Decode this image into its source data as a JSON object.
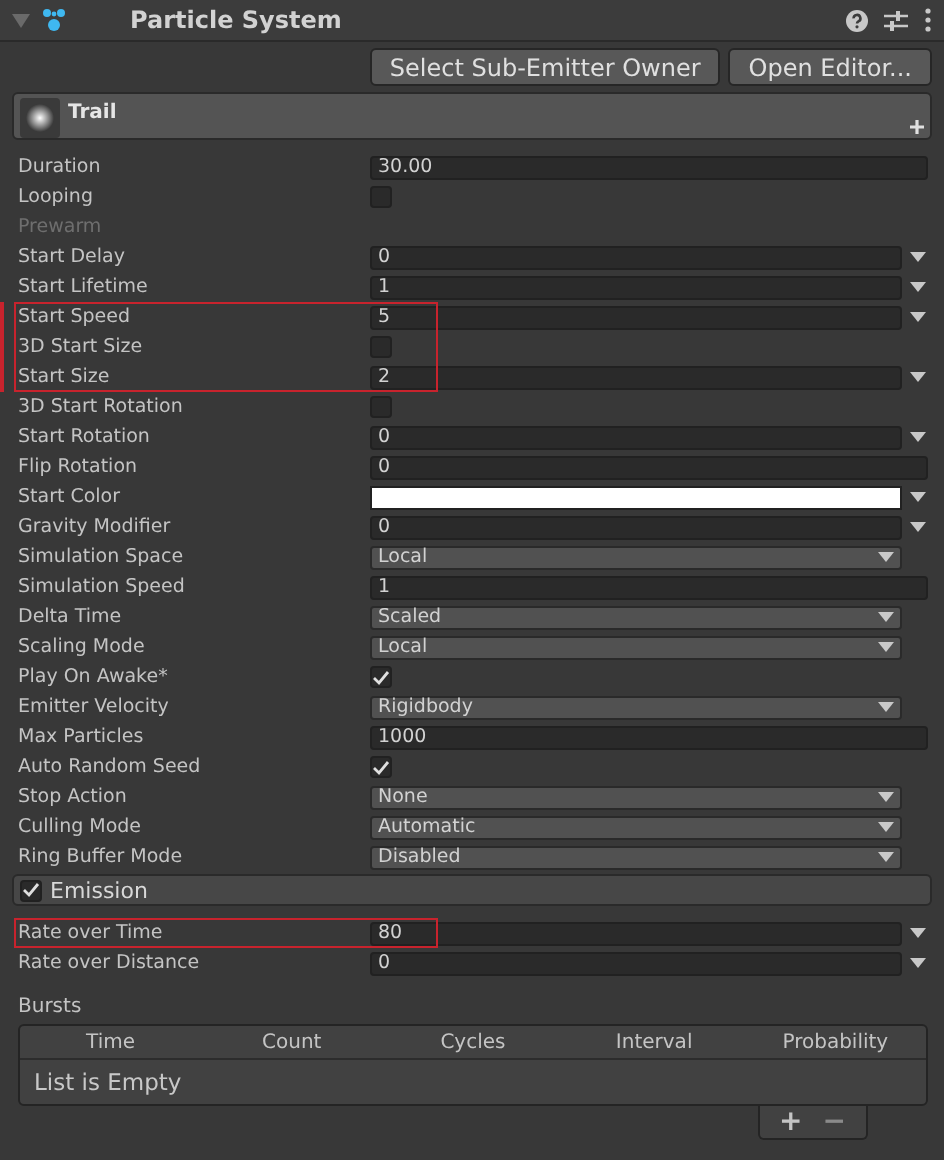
{
  "component": {
    "title": "Particle System",
    "expanded": true
  },
  "toolbar_buttons": [
    "Select Sub-Emitter Owner",
    "Open Editor..."
  ],
  "module": {
    "title": "Trail"
  },
  "rows": [
    {
      "label": "Duration",
      "kind": "field",
      "value": "30.00",
      "curve": false,
      "highlighted": false,
      "modified": false
    },
    {
      "label": "Looping",
      "kind": "checkbox",
      "checked": false,
      "highlighted": false,
      "modified": false
    },
    {
      "label": "Prewarm",
      "kind": "label",
      "disabled": true,
      "highlighted": false,
      "modified": false
    },
    {
      "label": "Start Delay",
      "kind": "field",
      "value": "0",
      "curve": true,
      "highlighted": false,
      "modified": false
    },
    {
      "label": "Start Lifetime",
      "kind": "field",
      "value": "1",
      "curve": true,
      "highlighted": false,
      "modified": false
    },
    {
      "label": "Start Speed",
      "kind": "field",
      "value": "5",
      "curve": true,
      "highlighted": true,
      "modified": true
    },
    {
      "label": "3D Start Size",
      "kind": "checkbox",
      "checked": false,
      "highlighted": true,
      "modified": true
    },
    {
      "label": "Start Size",
      "kind": "field",
      "value": "2",
      "curve": true,
      "highlighted": true,
      "modified": true
    },
    {
      "label": "3D Start Rotation",
      "kind": "checkbox",
      "checked": false,
      "highlighted": false,
      "modified": false
    },
    {
      "label": "Start Rotation",
      "kind": "field",
      "value": "0",
      "curve": true,
      "highlighted": false,
      "modified": false
    },
    {
      "label": "Flip Rotation",
      "kind": "field",
      "value": "0",
      "curve": false,
      "highlighted": false,
      "modified": false
    },
    {
      "label": "Start Color",
      "kind": "color",
      "color": "#ffffff",
      "highlighted": false,
      "modified": false
    },
    {
      "label": "Gravity Modifier",
      "kind": "field",
      "value": "0",
      "curve": true,
      "highlighted": false,
      "modified": false
    },
    {
      "label": "Simulation Space",
      "kind": "dropdown",
      "value": "Local",
      "highlighted": false,
      "modified": false
    },
    {
      "label": "Simulation Speed",
      "kind": "field",
      "value": "1",
      "curve": false,
      "highlighted": false,
      "modified": false
    },
    {
      "label": "Delta Time",
      "kind": "dropdown",
      "value": "Scaled",
      "highlighted": false,
      "modified": false
    },
    {
      "label": "Scaling Mode",
      "kind": "dropdown",
      "value": "Local",
      "highlighted": false,
      "modified": false
    },
    {
      "label": "Play On Awake*",
      "kind": "checkbox",
      "checked": true,
      "highlighted": false,
      "modified": false
    },
    {
      "label": "Emitter Velocity",
      "kind": "dropdown",
      "value": "Rigidbody",
      "highlighted": false,
      "modified": false
    },
    {
      "label": "Max Particles",
      "kind": "field",
      "value": "1000",
      "curve": false,
      "highlighted": false,
      "modified": false
    },
    {
      "label": "Auto Random Seed",
      "kind": "checkbox",
      "checked": true,
      "highlighted": false,
      "modified": false
    },
    {
      "label": "Stop Action",
      "kind": "dropdown",
      "value": "None",
      "highlighted": false,
      "modified": false
    },
    {
      "label": "Culling Mode",
      "kind": "dropdown",
      "value": "Automatic",
      "highlighted": false,
      "modified": false
    },
    {
      "label": "Ring Buffer Mode",
      "kind": "dropdown",
      "value": "Disabled",
      "highlighted": false,
      "modified": false
    }
  ],
  "emission": {
    "title": "Emission",
    "checked": true,
    "rows": [
      {
        "label": "Rate over Time",
        "kind": "field",
        "value": "80",
        "curve": true,
        "highlighted": true,
        "modified": false
      },
      {
        "label": "Rate over Distance",
        "kind": "field",
        "value": "0",
        "curve": true,
        "highlighted": false,
        "modified": false
      }
    ],
    "bursts": {
      "title": "Bursts",
      "columns": [
        "Time",
        "Count",
        "Cycles",
        "Interval",
        "Probability"
      ],
      "empty_text": "List is Empty",
      "add": "+",
      "remove": "−"
    }
  }
}
